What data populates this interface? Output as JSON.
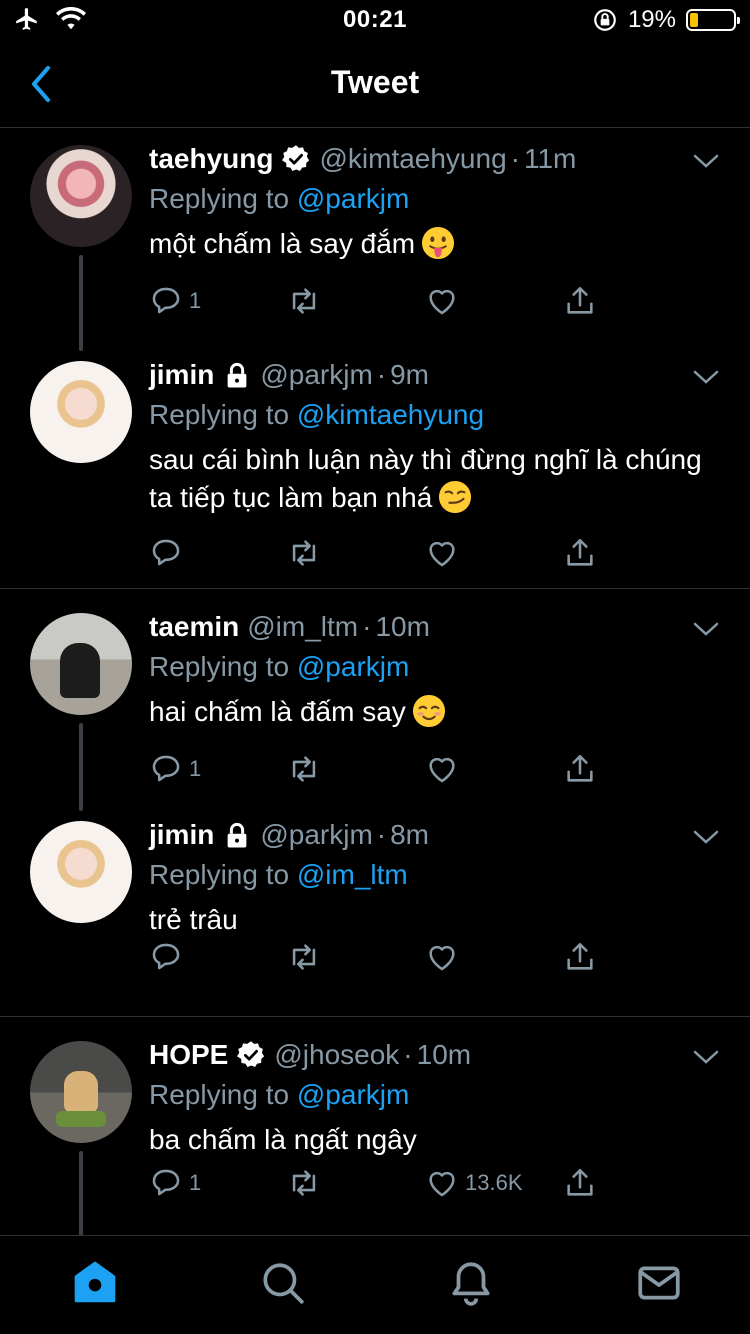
{
  "status_bar": {
    "time": "00:21",
    "battery_percent_label": "19%",
    "battery_level": 0.19,
    "battery_color": "#f5c400",
    "icons": [
      "airplane-icon",
      "wifi-icon",
      "orientation-lock-icon",
      "battery-icon"
    ]
  },
  "header": {
    "title": "Tweet",
    "back_icon": "chevron-left-icon"
  },
  "colors": {
    "accent": "#1da1f2",
    "secondary_text": "#8899a6",
    "background": "#000000",
    "divider": "#2f3336"
  },
  "replying_prefix": "Replying to",
  "tweets": [
    {
      "name": "taehyung",
      "verified": true,
      "handle": "@kimtaehyung",
      "time": "11m",
      "reply_to": "@parkjm",
      "text": "một chấm là say đắm",
      "emoji": "tongue-out-emoji",
      "reply_count": "1",
      "like_count": ""
    },
    {
      "name": "jimin",
      "protected": true,
      "handle": "@parkjm",
      "time": "9m",
      "reply_to": "@kimtaehyung",
      "text": "sau cái bình luận này thì đừng nghĩ là chúng ta tiếp tục làm bạn nhá",
      "emoji": "smirk-emoji",
      "reply_count": "",
      "like_count": ""
    },
    {
      "name": "taemin",
      "handle": "@im_ltm",
      "time": "10m",
      "reply_to": "@parkjm",
      "text": "hai chấm là đấm say",
      "emoji": "blush-emoji",
      "reply_count": "1",
      "like_count": ""
    },
    {
      "name": "jimin",
      "protected": true,
      "handle": "@parkjm",
      "time": "8m",
      "reply_to": "@im_ltm",
      "text": "trẻ trâu",
      "reply_count": "",
      "like_count": ""
    },
    {
      "name": "HOPE",
      "verified": true,
      "handle": "@jhoseok",
      "time": "10m",
      "reply_to": "@parkjm",
      "text": "ba chấm là ngất ngây",
      "reply_count": "1",
      "like_count": "13.6K"
    }
  ],
  "tab_bar": {
    "tabs": [
      "home-icon",
      "search-icon",
      "notifications-icon",
      "messages-icon"
    ],
    "active": "home-icon"
  }
}
